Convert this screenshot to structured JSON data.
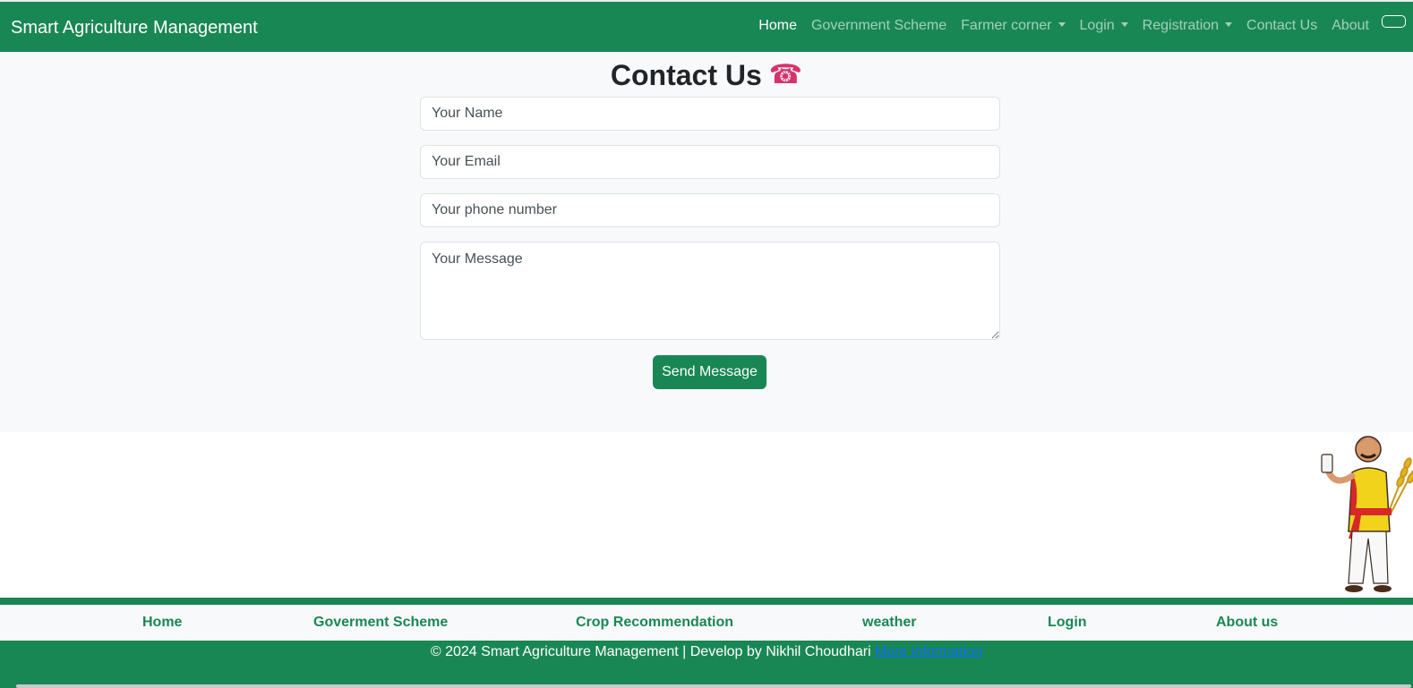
{
  "navbar": {
    "brand": "Smart Agriculture Management",
    "items": [
      {
        "label": "Home",
        "active": true
      },
      {
        "label": "Government Scheme"
      },
      {
        "label": "Farmer corner",
        "dropdown": true
      },
      {
        "label": "Login",
        "dropdown": true
      },
      {
        "label": "Registration",
        "dropdown": true
      },
      {
        "label": "Contact Us"
      },
      {
        "label": "About"
      }
    ]
  },
  "contact": {
    "title": "Contact Us",
    "icon": "telephone-icon",
    "name_placeholder": "Your Name",
    "email_placeholder": "Your Email",
    "phone_placeholder": "Your phone number",
    "message_placeholder": "Your Message",
    "send_label": "Send Message"
  },
  "footer": {
    "links": [
      "Home",
      "Goverment Scheme",
      "Crop Recommendation",
      "weather",
      "Login",
      "About us"
    ],
    "copyright": "© 2024 Smart Agriculture Management | Develop by Nikhil Choudhari",
    "more_info": "More information"
  },
  "colors": {
    "primary": "#198754",
    "section_bg": "#f8f9fa",
    "link_blue": "#0d6efd"
  }
}
